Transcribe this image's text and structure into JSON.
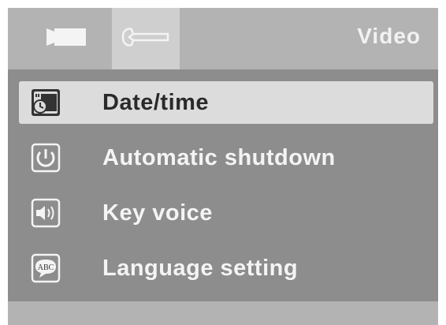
{
  "header": {
    "tabs": [
      {
        "icon": "camera-icon",
        "active": false
      },
      {
        "icon": "wrench-icon",
        "active": true
      }
    ],
    "title": "Video"
  },
  "menu": {
    "items": [
      {
        "label": "Date/time",
        "icon": "calendar-clock-icon",
        "selected": true
      },
      {
        "label": "Automatic shutdown",
        "icon": "power-icon",
        "selected": false
      },
      {
        "label": "Key voice",
        "icon": "speaker-icon",
        "selected": false
      },
      {
        "label": "Language setting",
        "icon": "abc-speech-bubble-icon",
        "selected": false
      }
    ]
  },
  "colors": {
    "screen_bg": "#8d8d8d",
    "header_bg": "#b3b3b3",
    "selected_bg": "#dcdcdc"
  }
}
